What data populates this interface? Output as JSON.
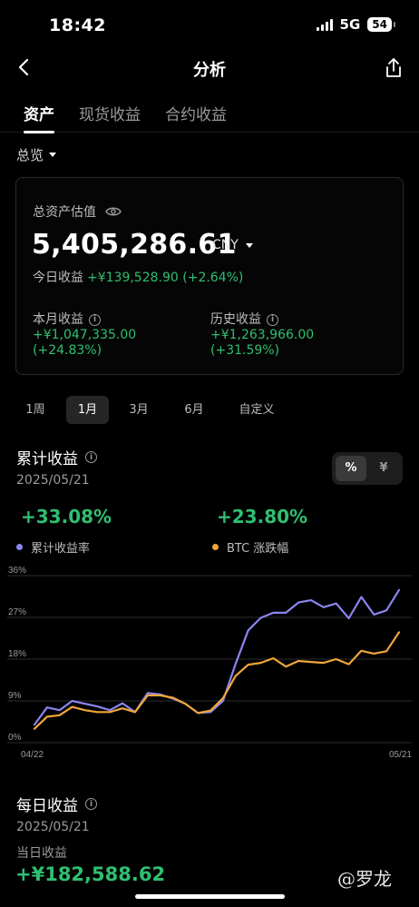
{
  "status_bar": {
    "time": "18:42",
    "network": "5G",
    "battery": "54"
  },
  "nav": {
    "title": "分析",
    "back_icon": "chevron-left-icon",
    "share_icon": "share-icon"
  },
  "tabs": [
    {
      "label": "资产",
      "active": true
    },
    {
      "label": "现货收益",
      "active": false
    },
    {
      "label": "合约收益",
      "active": false
    }
  ],
  "overview_select": {
    "label": "总览"
  },
  "summary_card": {
    "label": "总资产估值",
    "amount": "5,405,286.61",
    "currency": "CNY",
    "today_label": "今日收益",
    "today_value": "+¥139,528.90 (+2.64%)",
    "month": {
      "label": "本月收益",
      "value": "+¥1,047,335.00",
      "pct": "(+24.83%)"
    },
    "history": {
      "label": "历史收益",
      "value": "+¥1,263,966.00",
      "pct": "(+31.59%)"
    }
  },
  "periods": [
    {
      "label": "1周",
      "active": false
    },
    {
      "label": "1月",
      "active": true
    },
    {
      "label": "3月",
      "active": false
    },
    {
      "label": "6月",
      "active": false
    },
    {
      "label": "自定义",
      "active": false
    }
  ],
  "cumulative": {
    "title": "累计收益",
    "date": "2025/05/21",
    "toggle": {
      "percent": "%",
      "yuan": "¥",
      "active": "percent"
    },
    "return_pct": "+33.08%",
    "btc_pct": "+23.80%",
    "legend_return": "累计收益率",
    "legend_btc": "BTC 涨跌幅"
  },
  "colors": {
    "positive": "#2fbf71",
    "series_return": "#8a86f0",
    "series_btc": "#f0a63a",
    "background": "#000000"
  },
  "chart_data": {
    "type": "line",
    "x_labels": [
      "04/22",
      "05/21"
    ],
    "y_ticks": [
      "0%",
      "9%",
      "18%",
      "27%",
      "36%"
    ],
    "ylim": [
      0,
      36
    ],
    "grid": true,
    "series": [
      {
        "name": "累计收益率",
        "values": [
          3.9,
          7.6,
          7.0,
          9.0,
          8.4,
          7.8,
          7.0,
          8.5,
          6.6,
          10.7,
          10.4,
          9.5,
          8.4,
          6.4,
          6.6,
          9.0,
          17.0,
          24.2,
          26.9,
          28.0,
          28.0,
          30.2,
          30.7,
          29.2,
          30.0,
          26.8,
          31.4,
          27.6,
          28.5,
          32.9
        ]
      },
      {
        "name": "BTC 涨跌幅",
        "values": [
          3.0,
          5.6,
          5.9,
          7.7,
          7.0,
          6.6,
          6.6,
          7.4,
          6.6,
          10.2,
          10.2,
          9.7,
          8.4,
          6.4,
          6.9,
          9.6,
          14.4,
          16.8,
          17.2,
          18.2,
          16.4,
          17.6,
          17.4,
          17.2,
          18.0,
          16.9,
          19.8,
          19.2,
          19.7,
          23.8
        ]
      }
    ]
  },
  "daily": {
    "title": "每日收益",
    "date": "2025/05/21",
    "label": "当日收益",
    "value": "+¥182,588.62"
  },
  "watermark": "@罗龙"
}
